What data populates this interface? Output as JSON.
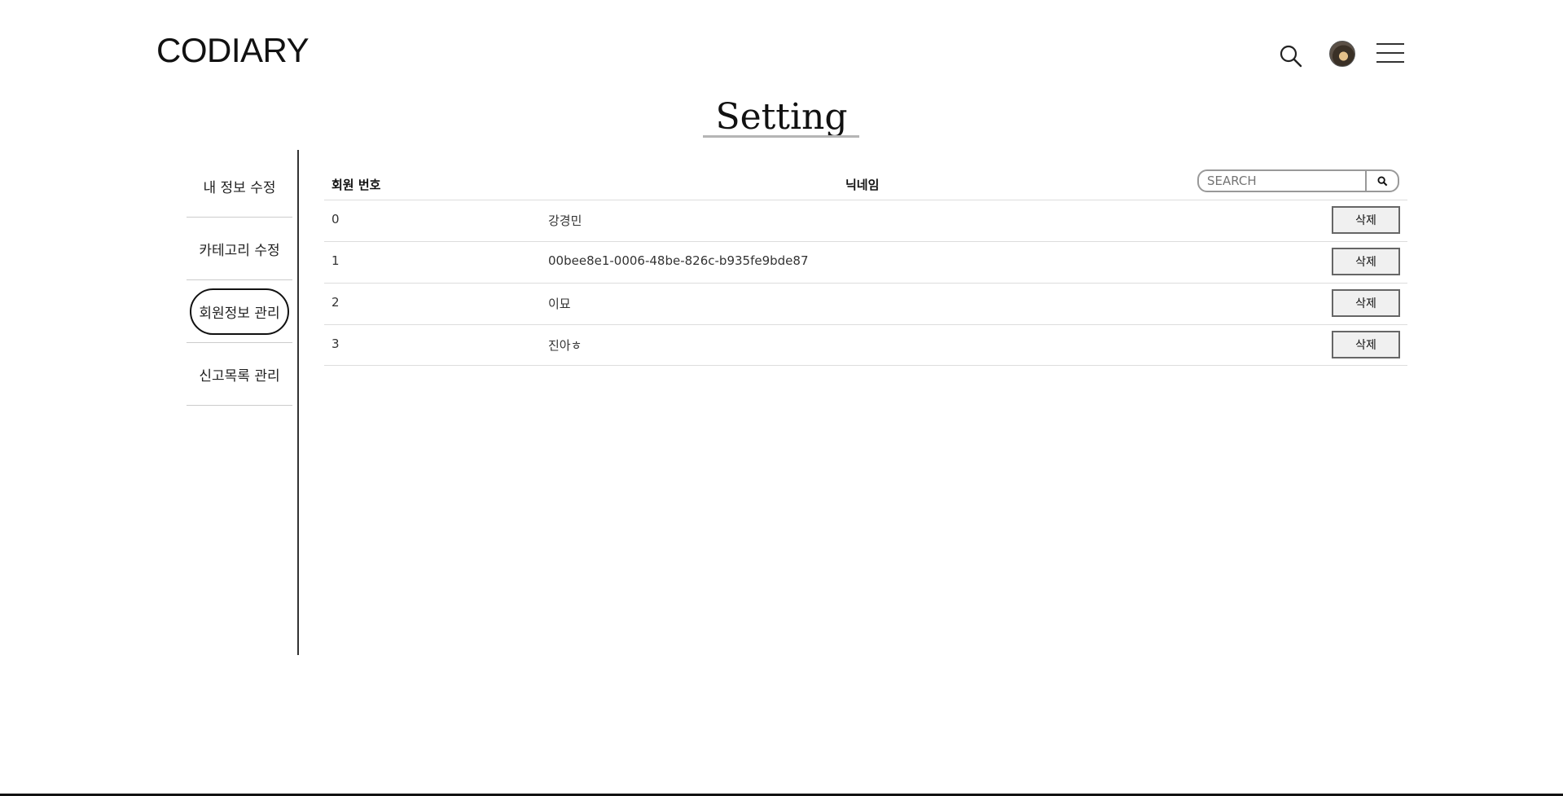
{
  "header": {
    "logo": "CODIARY",
    "icons": [
      "search-icon",
      "avatar",
      "menu-icon"
    ]
  },
  "page": {
    "title": "Setting"
  },
  "sidebar": {
    "items": [
      {
        "label": "내 정보 수정",
        "active": false
      },
      {
        "label": "카테고리 수정",
        "active": false
      },
      {
        "label": "회원정보 관리",
        "active": true
      },
      {
        "label": "신고목록 관리",
        "active": false
      }
    ]
  },
  "table": {
    "headers": {
      "number": "회원 번호",
      "nickname": "닉네임"
    },
    "search_placeholder": "SEARCH",
    "delete_label": "삭제",
    "rows": [
      {
        "number": "0",
        "nickname": "강경민"
      },
      {
        "number": "1",
        "nickname": "00bee8e1-0006-48be-826c-b935fe9bde87"
      },
      {
        "number": "2",
        "nickname": "이묘"
      },
      {
        "number": "3",
        "nickname": "진아ㅎ"
      }
    ]
  }
}
